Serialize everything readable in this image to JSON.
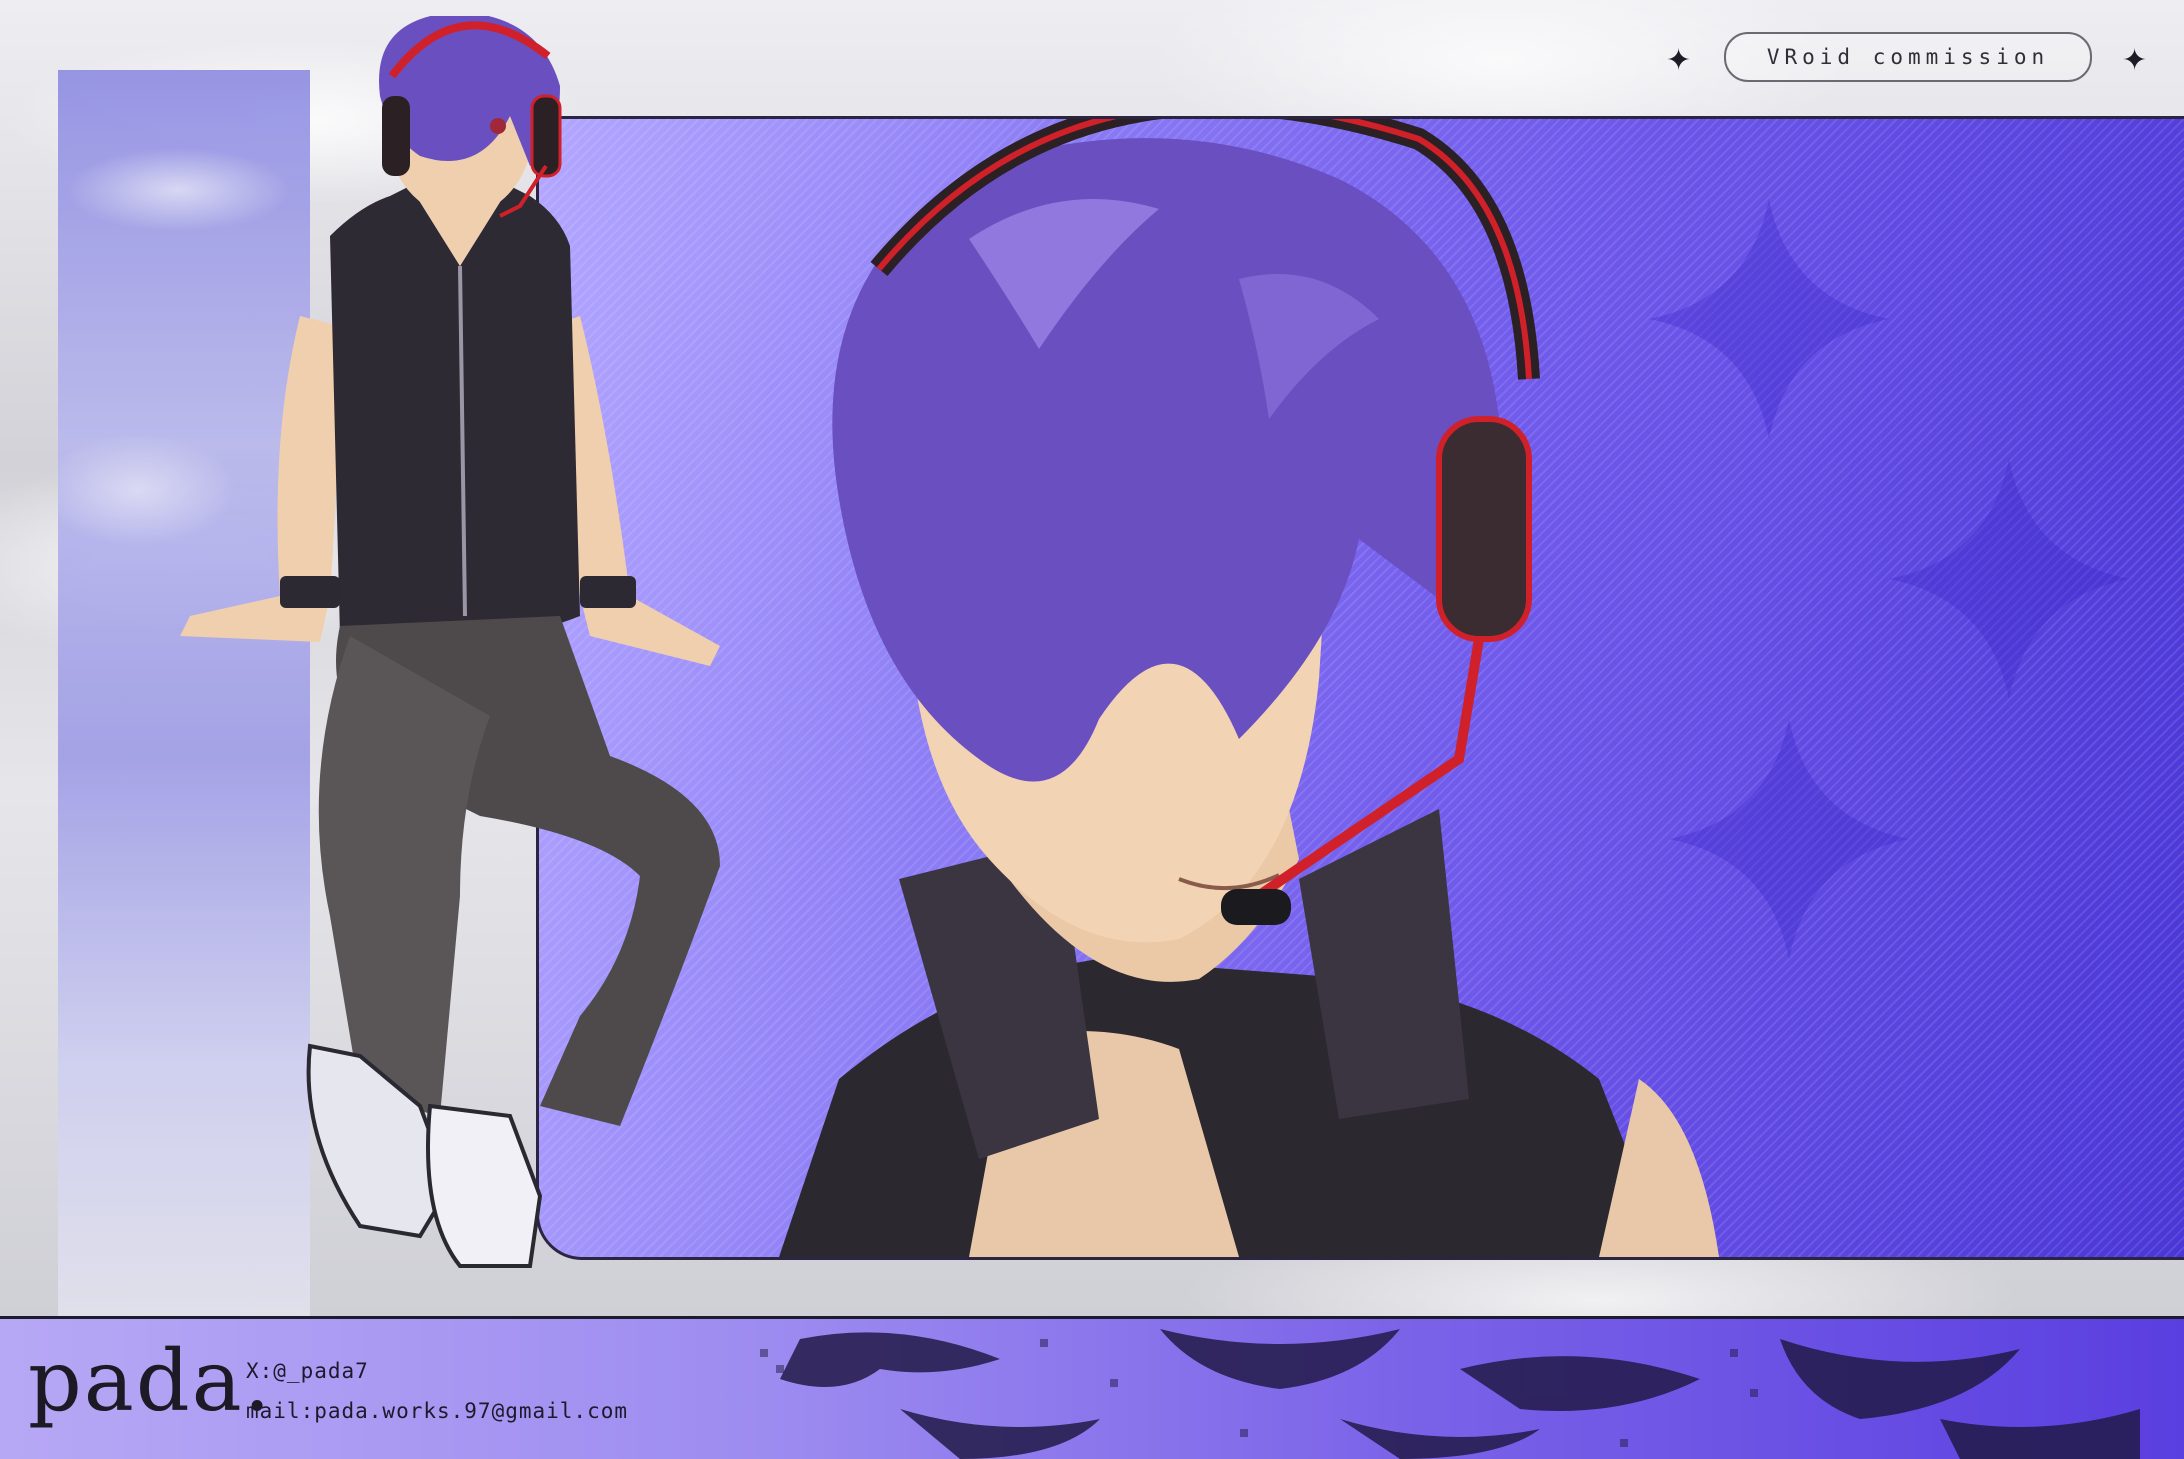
{
  "header": {
    "badge_text": "VRoid commission",
    "star_glyph": "✦"
  },
  "footer": {
    "brand": "pada.",
    "x_handle": "X:@_pada7",
    "mail": "mail:pada.works.97@gmail.com"
  },
  "colors": {
    "panel_light": "#b3a7ff",
    "panel_dark": "#4a36d6",
    "hair": "#6a4fc0",
    "headset_red": "#d0202a"
  }
}
